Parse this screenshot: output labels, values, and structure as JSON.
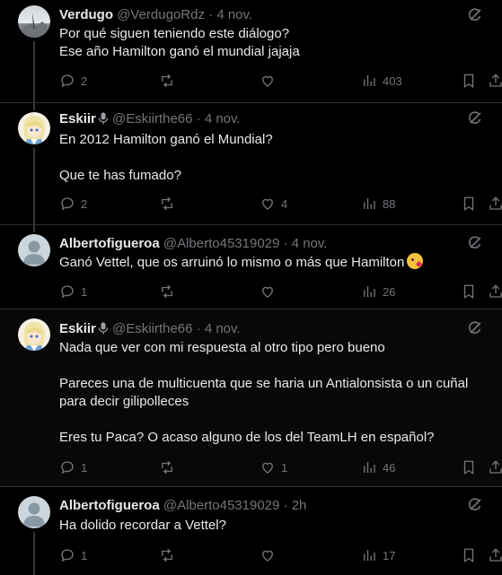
{
  "tweets": [
    {
      "name": "Verdugo",
      "handle": "@VerdugoRdz",
      "time": "4 nov.",
      "text": "Por qué siguen teniendo este diálogo?\nEse año Hamilton ganó el mundial jajaja",
      "replies": "2",
      "likes": "",
      "views": "403"
    },
    {
      "name": "Eskiir",
      "handle": "@Eskiirthe66",
      "time": "4 nov.",
      "text": "En 2012 Hamilton ganó el Mundial?\n\nQue te has fumado?",
      "replies": "2",
      "likes": "4",
      "views": "88"
    },
    {
      "name": "Albertofigueroa",
      "handle": "@Alberto45319029",
      "time": "4 nov.",
      "text": "Ganó Vettel, que os arruinó lo mismo o más que Hamilton",
      "replies": "1",
      "likes": "",
      "views": "26"
    },
    {
      "name": "Eskiir",
      "handle": "@Eskiirthe66",
      "time": "4 nov.",
      "text": "Nada que ver con mi respuesta al otro tipo pero bueno\n\nPareces una de multicuenta que se haria un Antialonsista o un cuñal para decir gilipolleces\n\nEres tu Paca? O acaso alguno de los del TeamLH en español?",
      "replies": "1",
      "likes": "1",
      "views": "46"
    },
    {
      "name": "Albertofigueroa",
      "handle": "@Alberto45319029",
      "time": "2h",
      "text": "Ha dolido recordar a Vettel?",
      "replies": "1",
      "likes": "",
      "views": "17"
    }
  ],
  "separator": "·",
  "icons": {
    "reply": "reply-icon",
    "retweet": "retweet-icon",
    "like": "heart-icon",
    "views": "views-icon",
    "bookmark": "bookmark-icon",
    "share": "share-icon",
    "grok": "grok-icon"
  },
  "colors": {
    "background": "#000000",
    "text": "#e7e9ea",
    "muted": "#71767b",
    "line": "#333639"
  }
}
